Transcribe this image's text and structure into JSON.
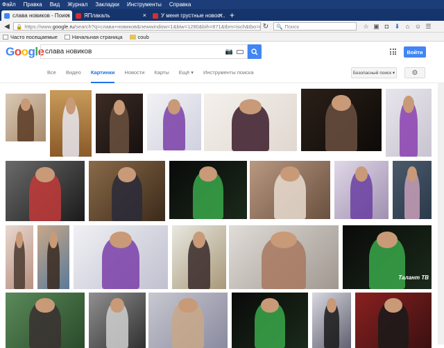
{
  "browser": {
    "menu": [
      "Файл",
      "Правка",
      "Вид",
      "Журнал",
      "Закладки",
      "Инструменты",
      "Справка"
    ],
    "tabs": [
      {
        "title": "слава новиков - Поиск ...",
        "active": true,
        "color": "#4285f4"
      },
      {
        "title": "ЯПлакаль",
        "active": false,
        "color": "#d32f2f"
      },
      {
        "title": "У меня грустные новост...",
        "active": false,
        "color": "#d32f2f"
      }
    ],
    "new_tab": "+",
    "url_prefix": "https://www.",
    "url_domain": "google.ru",
    "url_rest": "/search?q=слава+новиков&newwindow=1&biw=1280&bih=871&tbm=isch&tbo=u&source",
    "search_placeholder": "Поиск",
    "bookmarks": [
      "Часто посещаемые",
      "Начальная страница",
      "coub"
    ]
  },
  "google": {
    "logo": "Google",
    "query": "слава новиков",
    "signin": "Войти",
    "tabs": [
      "Все",
      "Видео",
      "Картинки",
      "Новости",
      "Карты",
      "Ещё ▾",
      "Инструменты поиска"
    ],
    "active_tab": 2,
    "safe_search": "Безопасный поиск ▾"
  },
  "images": [
    {
      "bg": "linear-gradient(135deg,#d9c9b6,#a88a6a)",
      "fg": "#5a3b25"
    },
    {
      "bg": "linear-gradient(180deg,#c89a5a,#8a5a28)",
      "fg": "#e8e8f0"
    },
    {
      "bg": "linear-gradient(135deg,#3d2c24,#161010)",
      "fg": "#6b5140"
    },
    {
      "bg": "linear-gradient(135deg,#f2f2f5,#d0d0e0)",
      "fg": "#7a3fa8"
    },
    {
      "bg": "linear-gradient(135deg,#f4f0ec,#e0d8d0)",
      "fg": "#3a1b2a"
    },
    {
      "bg": "linear-gradient(135deg,#2b2018,#0d0a08)",
      "fg": "#6a5040"
    },
    {
      "bg": "linear-gradient(135deg,#e8e6ec,#c8c4d0)",
      "fg": "#8a3fb0"
    },
    {
      "bg": "linear-gradient(135deg,#6a6a6a,#1a1a1a)",
      "fg": "#c23a3a"
    },
    {
      "bg": "linear-gradient(135deg,#8a6a48,#3a2a1a)",
      "fg": "#2a2a3a"
    },
    {
      "bg": "linear-gradient(135deg,#0a0a0a,#1a2a1a)",
      "fg": "#3aa84a"
    },
    {
      "bg": "linear-gradient(135deg,#b89880,#6a5040)",
      "fg": "#e8dcd0"
    },
    {
      "bg": "linear-gradient(135deg,#e0d8e8,#a090b0)",
      "fg": "#6a3fa0"
    },
    {
      "bg": "linear-gradient(135deg,#4a5a6a,#2a3a4a)",
      "fg": "#c8a0b8"
    },
    {
      "bg": "linear-gradient(135deg,#e8d8d0,#b89080)",
      "fg": "#4a3a30"
    },
    {
      "bg": "linear-gradient(135deg,#c8a888,#5a7a9a)",
      "fg": "#3a2a20"
    },
    {
      "bg": "linear-gradient(135deg,#f0f0f4,#c0c0d0)",
      "fg": "#7a3fa8"
    },
    {
      "bg": "linear-gradient(135deg,#e8e8e0,#a89878)",
      "fg": "#3a2a2a"
    },
    {
      "bg": "linear-gradient(135deg,#e0dcd8,#a09890)",
      "fg": "#a87860"
    },
    {
      "bg": "linear-gradient(135deg,#0a0a0a,#1a2a1a)",
      "fg": "#3aa84a"
    },
    {
      "bg": "linear-gradient(135deg,#5a8a5a,#2a4a2a)",
      "fg": "#3a3030"
    },
    {
      "bg": "linear-gradient(135deg,#909090,#303030)",
      "fg": "#d0d0d0"
    },
    {
      "bg": "linear-gradient(135deg,#c8c8d0,#8a8aa0)",
      "fg": "#c8a888"
    },
    {
      "bg": "linear-gradient(135deg,#0a0a0a,#1a2a1a)",
      "fg": "#3aa84a"
    },
    {
      "bg": "linear-gradient(135deg,#d8d8e0,#606070)",
      "fg": "#1a1a1a"
    },
    {
      "bg": "linear-gradient(135deg,#8a2020,#3a1010)",
      "fg": "#1a1a1a"
    }
  ],
  "image_caption": "Талант ТВ"
}
